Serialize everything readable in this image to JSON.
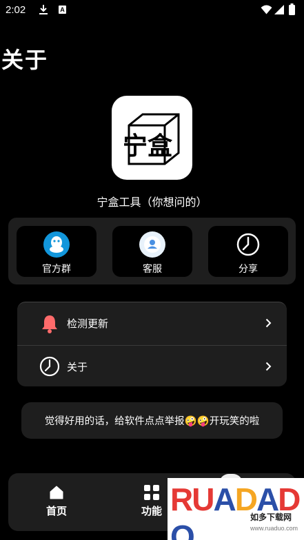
{
  "status_bar": {
    "time": "2:02",
    "notification_badge": "A"
  },
  "page": {
    "title": "关于"
  },
  "app": {
    "name": "宁盒工具（你想问的）",
    "logo_text": "宁盒"
  },
  "quick_actions": [
    {
      "label": "官方群",
      "icon": "qq-icon"
    },
    {
      "label": "客服",
      "icon": "customer-service-icon"
    },
    {
      "label": "分享",
      "icon": "clock-share-icon"
    }
  ],
  "menu": [
    {
      "label": "检测更新",
      "icon": "bell-icon"
    },
    {
      "label": "关于",
      "icon": "clock-icon"
    }
  ],
  "tip": {
    "text": "觉得好用的话，给软件点点举报🤪🤪开玩笑的啦"
  },
  "bottom_nav": [
    {
      "label": "首页",
      "icon": "home-icon"
    },
    {
      "label": "功能",
      "icon": "grid-icon"
    }
  ],
  "watermark": {
    "letters": [
      "R",
      "U",
      "A",
      "D",
      "A",
      "D",
      "O"
    ],
    "sub": "如多下载网",
    "url": "www.ruaduo.com"
  },
  "colors": {
    "background": "#000000",
    "card": "#1e1e1e",
    "bell": "#ff6b6b",
    "qq_blue": "#1296db",
    "accent_red": "#e53935"
  }
}
